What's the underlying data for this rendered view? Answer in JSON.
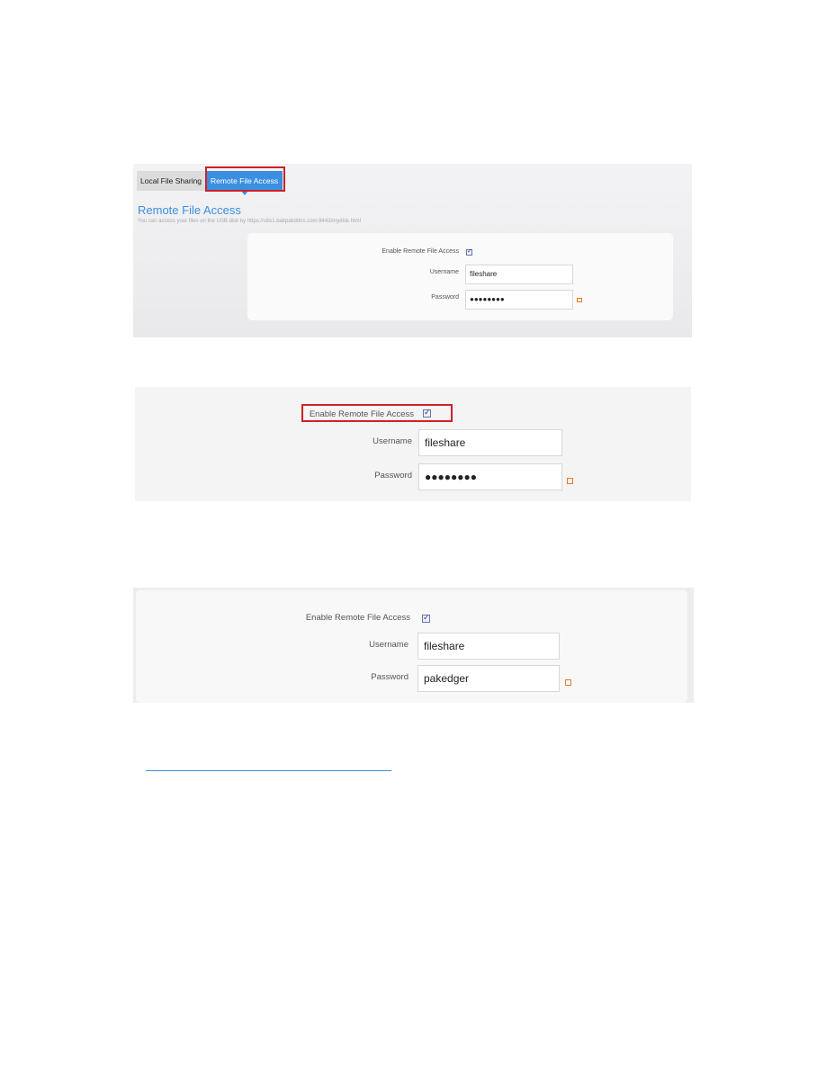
{
  "screenshot1": {
    "tabs": [
      {
        "label": "Local File Sharing",
        "active": false
      },
      {
        "label": "Remote File Access",
        "active": true
      }
    ],
    "title": "Remote File Access",
    "description": "You can access your files on the USB disk by https://site1.bakpakddns.com:8443/mydisk.html",
    "form": {
      "enable_label": "Enable Remote File Access",
      "enable_checked": true,
      "username_label": "Username",
      "username_value": "fileshare",
      "password_label": "Password",
      "password_value": "●●●●●●●●"
    }
  },
  "screenshot2": {
    "form": {
      "enable_label": "Enable Remote File Access",
      "enable_checked": true,
      "username_label": "Username",
      "username_value": "fileshare",
      "password_label": "Password",
      "password_value": "●●●●●●●●"
    }
  },
  "screenshot3": {
    "form": {
      "enable_label": "Enable Remote File Access",
      "enable_checked": true,
      "username_label": "Username",
      "username_value": "fileshare",
      "password_label": "Password",
      "password_value": "pakedger"
    }
  },
  "colors": {
    "accent": "#3a8fe0",
    "highlight": "#d21f26",
    "edit_icon": "#e07b2b"
  }
}
